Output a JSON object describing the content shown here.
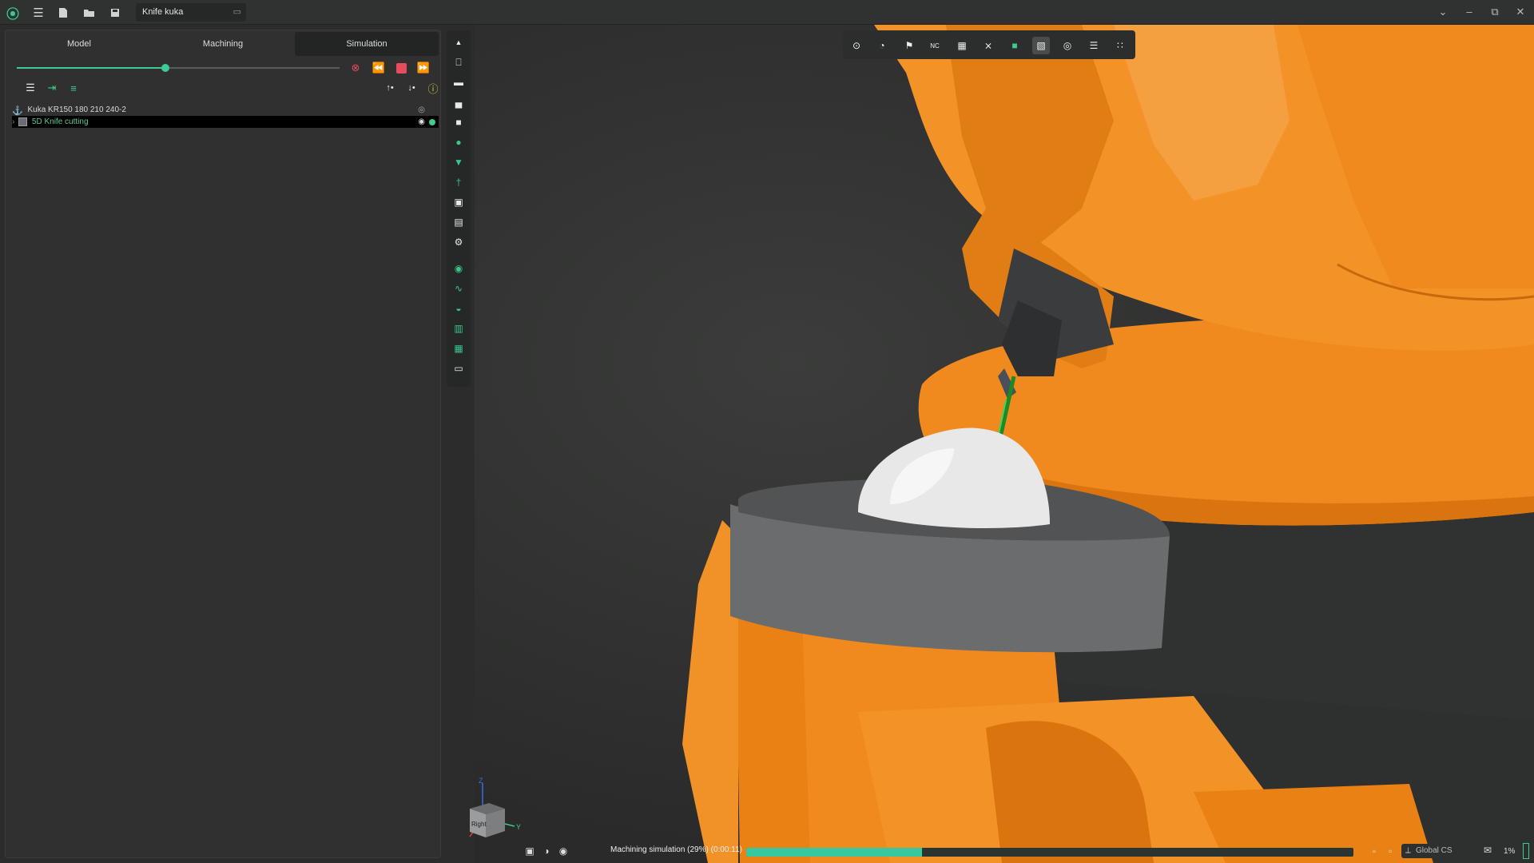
{
  "title_bar": {
    "document_tab": "Knife kuka",
    "icons": [
      "app-logo-icon",
      "menu-icon",
      "new-file-icon",
      "open-folder-icon",
      "save-icon"
    ],
    "window_controls": [
      "chevron-down-icon",
      "minimize-icon",
      "restore-icon",
      "close-icon"
    ]
  },
  "tabs": [
    {
      "label": "Model",
      "active": false
    },
    {
      "label": "Machining",
      "active": false
    },
    {
      "label": "Simulation",
      "active": true
    }
  ],
  "simulation": {
    "slider_progress": 0.46,
    "controls": [
      "cancel-icon",
      "rewind-icon",
      "stop-icon",
      "fast-forward-icon"
    ]
  },
  "tree": {
    "items": [
      {
        "label": "Kuka KR150 180 210 240-2",
        "selected": false
      },
      {
        "label": "5D Knife cutting",
        "selected": true
      }
    ]
  },
  "status": {
    "text": "Machining simulation (29%) (0:00:11)",
    "progress": 0.29,
    "coordinate_system": "Global CS",
    "zoom": "1%"
  },
  "colors": {
    "accent": "#3ecb8f",
    "robot_orange": "#f08a1e",
    "stock_gray": "#5f6162",
    "stop_red": "#e84a5f"
  }
}
